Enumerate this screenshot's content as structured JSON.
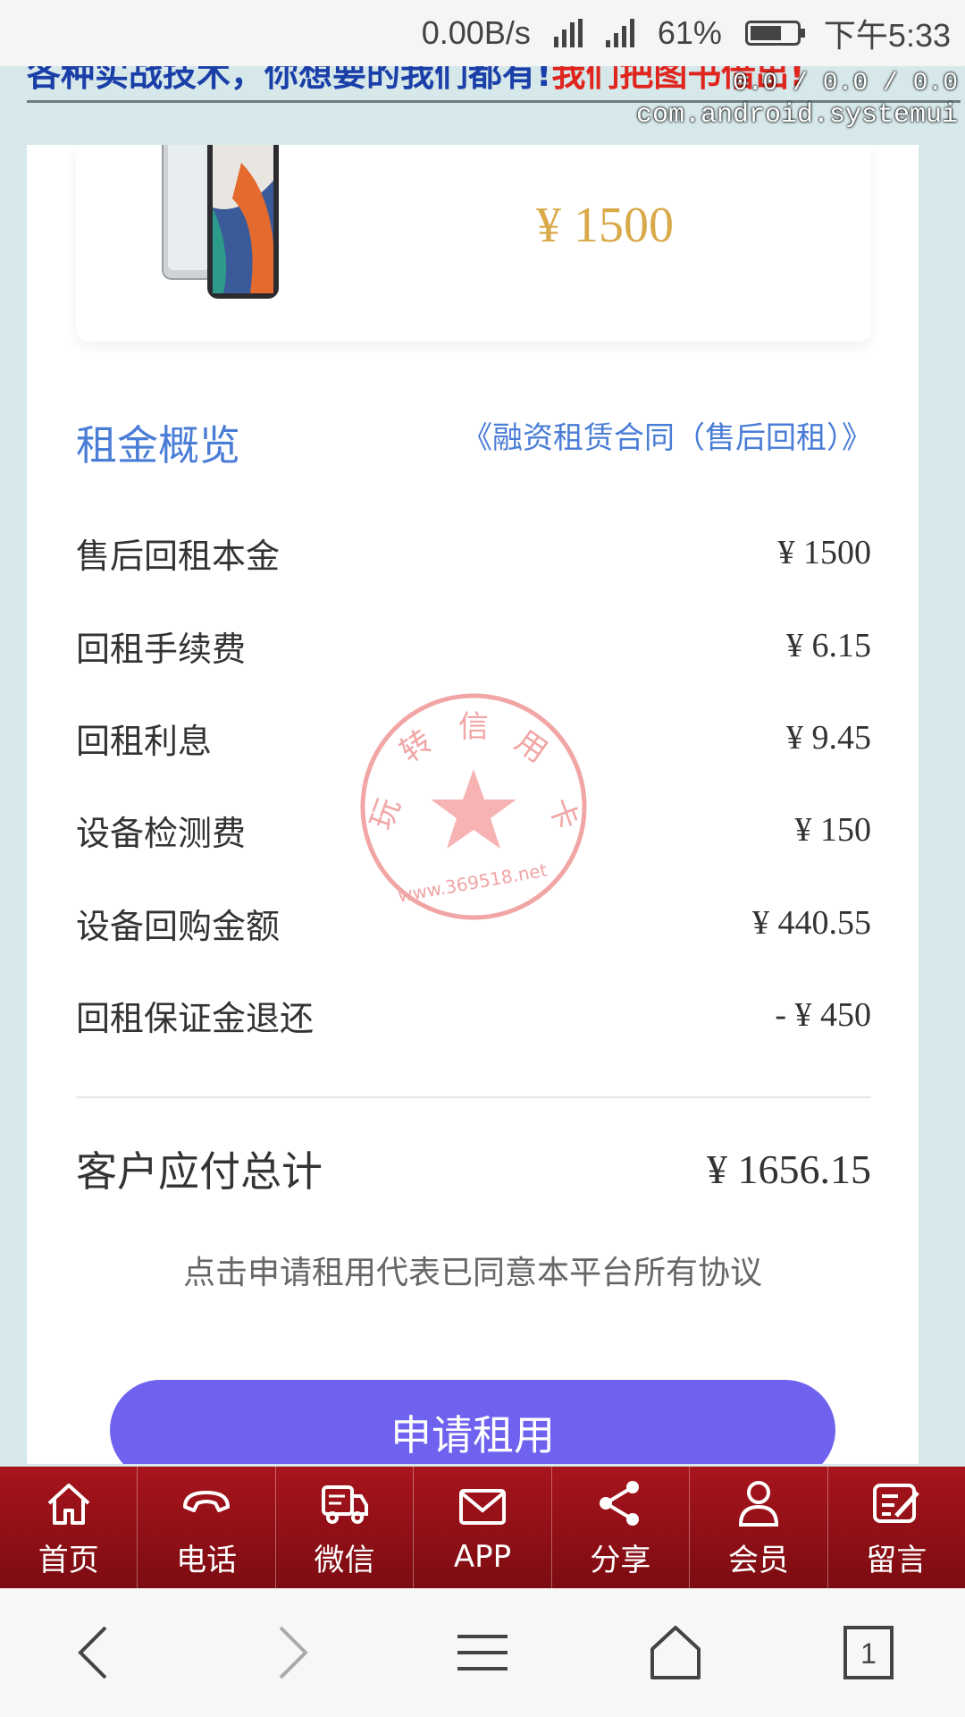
{
  "status_bar": {
    "speed": "0.00B/s",
    "battery": "61%",
    "time": "下午5:33"
  },
  "banner": {
    "text_blue": "各种实战技术，你想要的我们都有!",
    "text_red": "我们把图书借出!"
  },
  "overlay": {
    "numbers": "0.0 / 0.0 / 0.0",
    "package": "com.android.systemui"
  },
  "product": {
    "price": "¥ 1500"
  },
  "rent_overview": {
    "title": "租金概览",
    "contract_link": "《融资租赁合同（售后回租）》",
    "rows": [
      {
        "label": "售后回租本金",
        "value": "¥ 1500"
      },
      {
        "label": "回租手续费",
        "value": "¥ 6.15"
      },
      {
        "label": "回租利息",
        "value": "¥ 9.45"
      },
      {
        "label": "设备检测费",
        "value": "¥ 150"
      },
      {
        "label": "设备回购金额",
        "value": "¥ 440.55"
      },
      {
        "label": "回租保证金退还",
        "value": "- ¥ 450"
      }
    ],
    "total": {
      "label": "客户应付总计",
      "value": "¥ 1656.15"
    }
  },
  "stamp": {
    "text": "玩转信用卡",
    "url": "www.369518.net"
  },
  "agreement": "点击申请租用代表已同意本平台所有协议",
  "apply_button": "申请租用",
  "bottom_nav": [
    {
      "label": "首页",
      "icon": "home-icon"
    },
    {
      "label": "电话",
      "icon": "phone-icon"
    },
    {
      "label": "微信",
      "icon": "wechat-icon"
    },
    {
      "label": "APP",
      "icon": "mail-icon"
    },
    {
      "label": "分享",
      "icon": "share-icon"
    },
    {
      "label": "会员",
      "icon": "user-icon"
    },
    {
      "label": "留言",
      "icon": "message-icon"
    }
  ],
  "system_nav": {
    "tab_count": "1"
  },
  "colors": {
    "accent_blue": "#4a7dd6",
    "button_purple": "#6e62ef",
    "nav_red": "#8f1018",
    "price_gold": "#d9a94a"
  }
}
